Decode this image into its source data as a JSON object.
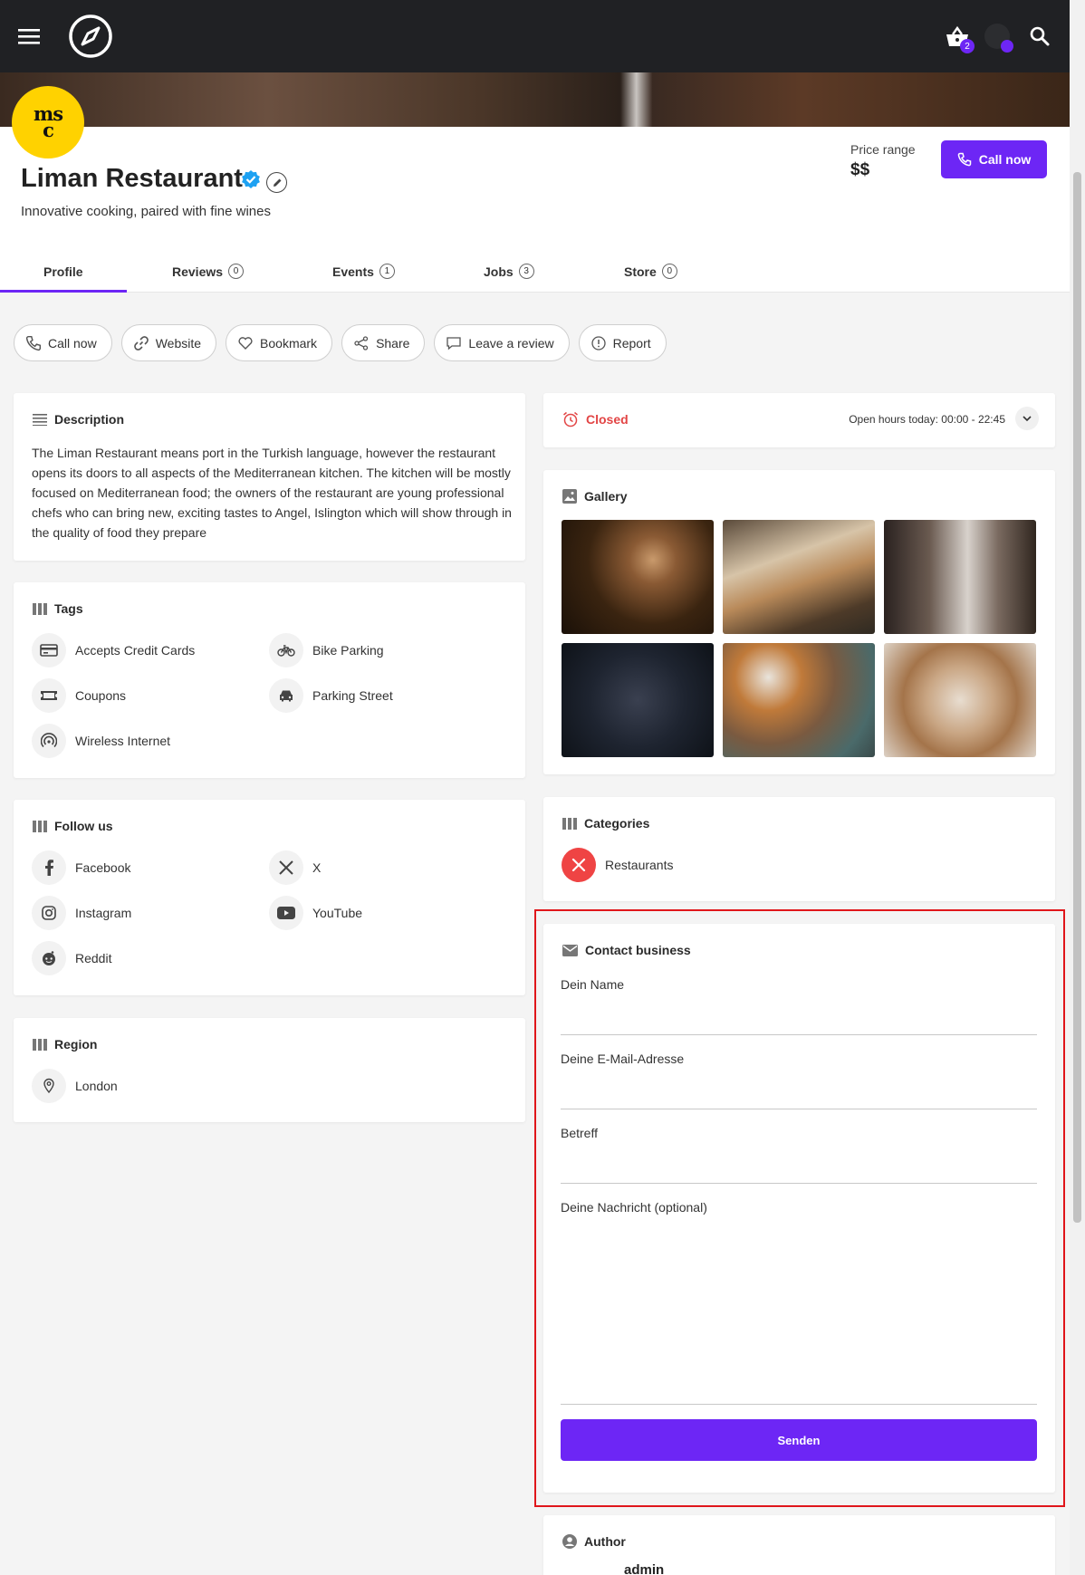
{
  "topbar": {
    "cart_count": "2"
  },
  "header": {
    "logo_text": "msc",
    "title": "Liman Restaurant",
    "tagline": "Innovative cooking, paired with fine wines",
    "price_label": "Price range",
    "price_value": "$$",
    "call_label": "Call now"
  },
  "tabs": [
    {
      "label": "Profile"
    },
    {
      "label": "Reviews",
      "count": "0"
    },
    {
      "label": "Events",
      "count": "1"
    },
    {
      "label": "Jobs",
      "count": "3"
    },
    {
      "label": "Store",
      "count": "0"
    }
  ],
  "actions": [
    "Call now",
    "Website",
    "Bookmark",
    "Share",
    "Leave a review",
    "Report"
  ],
  "description": {
    "title": "Description",
    "text": "The Liman Restaurant means port in the Turkish language, however the restaurant opens its doors to all aspects of the Mediterranean kitchen. The kitchen will be mostly focused on Mediterranean food; the owners of the restaurant are young professional chefs who can bring new, exciting tastes to Angel, Islington which will show through in the quality of food they prepare"
  },
  "tags": {
    "title": "Tags",
    "items": [
      {
        "label": "Accepts Credit Cards",
        "icon": "credit-card-icon"
      },
      {
        "label": "Bike Parking",
        "icon": "bike-icon"
      },
      {
        "label": "Coupons",
        "icon": "coupon-icon"
      },
      {
        "label": "Parking Street",
        "icon": "car-icon"
      },
      {
        "label": "Wireless Internet",
        "icon": "wifi-icon"
      }
    ]
  },
  "follow": {
    "title": "Follow us",
    "items": [
      {
        "label": "Facebook",
        "icon": "facebook-icon"
      },
      {
        "label": "X",
        "icon": "x-icon"
      },
      {
        "label": "Instagram",
        "icon": "instagram-icon"
      },
      {
        "label": "YouTube",
        "icon": "youtube-icon"
      },
      {
        "label": "Reddit",
        "icon": "reddit-icon"
      }
    ]
  },
  "region": {
    "title": "Region",
    "items": [
      {
        "label": "London",
        "icon": "location-pin-icon"
      }
    ]
  },
  "hours": {
    "status": "Closed",
    "text": "Open hours today: 00:00 - 22:45"
  },
  "gallery": {
    "title": "Gallery"
  },
  "categories": {
    "title": "Categories",
    "items": [
      {
        "label": "Restaurants",
        "icon": "fork-knife-icon"
      }
    ]
  },
  "contact": {
    "title": "Contact business",
    "name_label": "Dein Name",
    "email_label": "Deine E-Mail-Adresse",
    "subject_label": "Betreff",
    "message_label": "Deine Nachricht (optional)",
    "submit_label": "Senden"
  },
  "author": {
    "title": "Author",
    "name": "admin"
  },
  "colors": {
    "accent": "#6d26f5",
    "closed": "#e24545",
    "category": "#ef4444",
    "highlight": "#e0161b"
  }
}
